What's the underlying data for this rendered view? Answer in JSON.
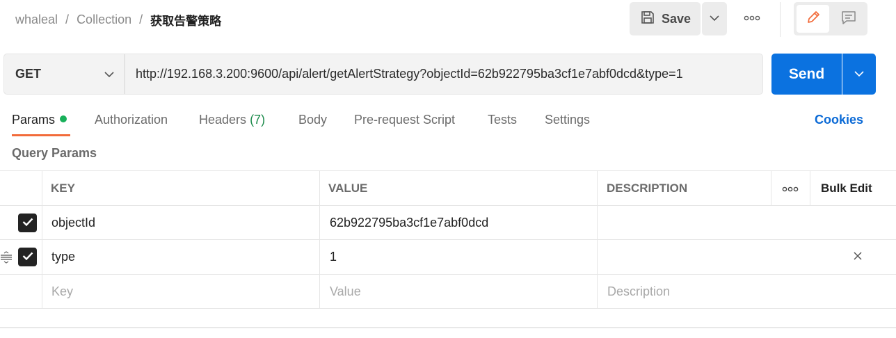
{
  "breadcrumb": {
    "workspace": "whaleal",
    "collection": "Collection",
    "request": "获取告警策略",
    "separator": "/"
  },
  "header": {
    "save_label": "Save"
  },
  "request": {
    "method": "GET",
    "url": "http://192.168.3.200:9600/api/alert/getAlertStrategy?objectId=62b922795ba3cf1e7abf0dcd&type=1",
    "send_label": "Send"
  },
  "tabs": [
    {
      "label": "Params"
    },
    {
      "label": "Authorization"
    },
    {
      "label": "Headers",
      "count": "(7)"
    },
    {
      "label": "Body"
    },
    {
      "label": "Pre-request Script"
    },
    {
      "label": "Tests"
    },
    {
      "label": "Settings"
    }
  ],
  "cookies_label": "Cookies",
  "query_params": {
    "title": "Query Params",
    "columns": {
      "key": "KEY",
      "value": "VALUE",
      "description": "DESCRIPTION",
      "bulk_edit": "Bulk Edit"
    },
    "rows": [
      {
        "key": "objectId",
        "value": "62b922795ba3cf1e7abf0dcd",
        "description": "",
        "checked": true
      },
      {
        "key": "type",
        "value": "1",
        "description": "",
        "checked": true
      }
    ],
    "placeholders": {
      "key": "Key",
      "value": "Value",
      "description": "Description"
    }
  },
  "colors": {
    "send": "#0b72e0",
    "active_tab_underline": "#f26b3a",
    "params_dot": "#18b05a",
    "cookies_link": "#0b6ad6",
    "headers_count": "#1a8a4a"
  },
  "icons": [
    "save-icon",
    "chevron-down-icon",
    "more-icon",
    "pencil-icon",
    "comment-icon",
    "checkbox-checked-icon",
    "drag-handle-icon",
    "close-icon"
  ]
}
